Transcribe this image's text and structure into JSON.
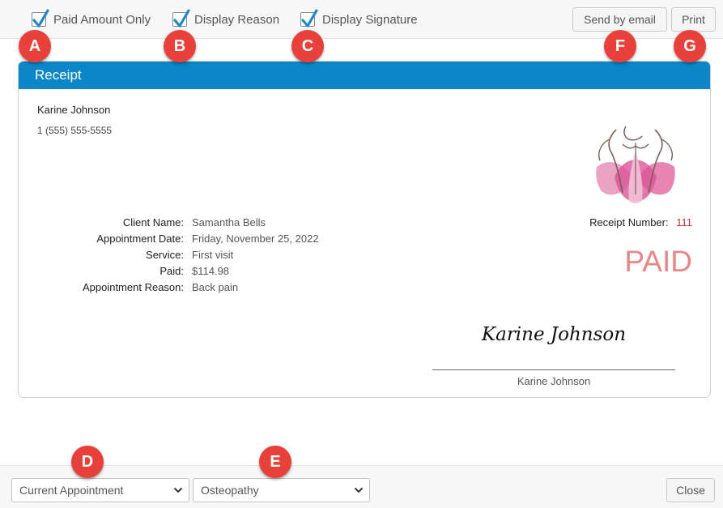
{
  "options": {
    "paid_amount_only": {
      "label": "Paid Amount Only",
      "checked": true
    },
    "display_reason": {
      "label": "Display Reason",
      "checked": true
    },
    "display_signature": {
      "label": "Display Signature",
      "checked": true
    }
  },
  "actions": {
    "send_email": "Send by email",
    "print": "Print",
    "close": "Close"
  },
  "markers": [
    "A",
    "B",
    "C",
    "D",
    "E",
    "F",
    "G"
  ],
  "receipt": {
    "title": "Receipt",
    "provider_name": "Karine Johnson",
    "provider_phone": "1 (555) 555-5555",
    "details": [
      {
        "label": "Client Name:",
        "value": "Samantha Bells"
      },
      {
        "label": "Appointment Date:",
        "value": "Friday, November 25, 2022"
      },
      {
        "label": "Service:",
        "value": "First visit"
      },
      {
        "label": "Paid:",
        "value": "$114.98"
      },
      {
        "label": "Appointment Reason:",
        "value": "Back pain"
      }
    ],
    "receipt_number_label": "Receipt Number:",
    "receipt_number": "111",
    "status": "PAID",
    "signature_script": "Karine Johnson",
    "signature_name": "Karine Johnson"
  },
  "footer": {
    "scope_select": "Current Appointment",
    "service_select": "Osteopathy"
  },
  "colors": {
    "header": "#0b86c8",
    "marker": "#e8403a",
    "paid": "#e8878a",
    "receipt_number": "#d0352f",
    "checkbox": "#1e88c9"
  },
  "icons": [
    "checkmark-icon",
    "chevron-down-icon",
    "logo-icon"
  ]
}
